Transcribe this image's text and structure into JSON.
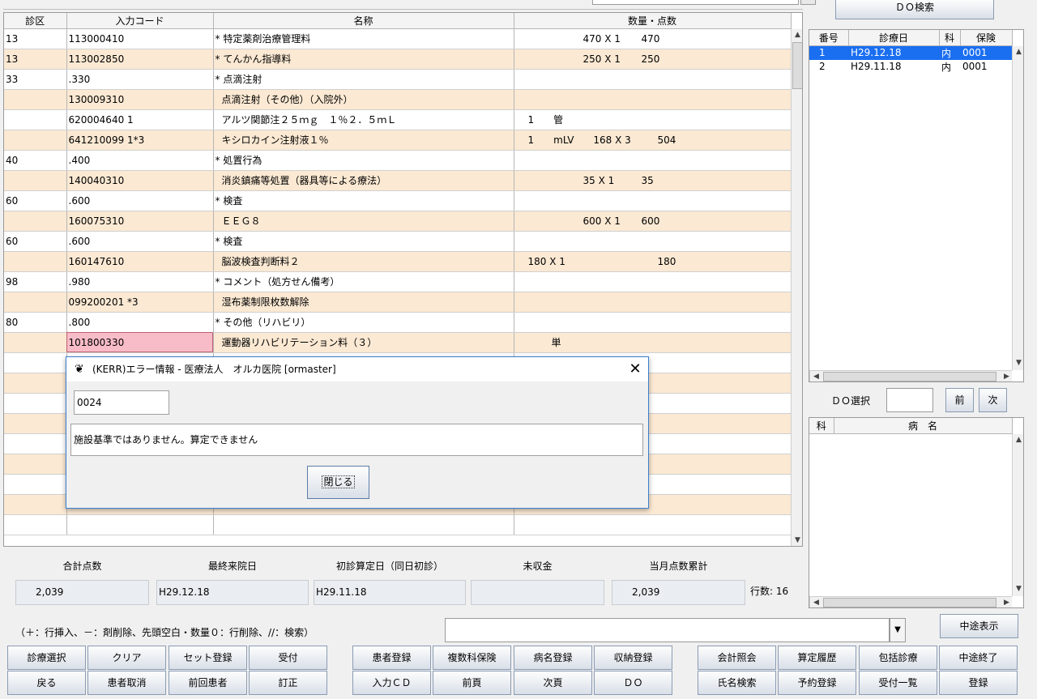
{
  "main_grid": {
    "headers": [
      "診区",
      "入力コード",
      "名称",
      "数量・点数"
    ],
    "rows": [
      {
        "shinku": "13",
        "code": "113000410",
        "name": "* 特定薬剤治療管理料",
        "qty": "470 X 1",
        "points": "470"
      },
      {
        "shinku": "13",
        "code": "113002850",
        "name": "* てんかん指導料",
        "qty": "250 X 1",
        "points": "250"
      },
      {
        "shinku": "33",
        "code": ".330",
        "name": "* 点滴注射",
        "qty": "",
        "points": ""
      },
      {
        "shinku": "",
        "code": "130009310",
        "name": "点滴注射（その他）（入院外）",
        "qty": "",
        "points": ""
      },
      {
        "shinku": "",
        "code": "620004640 1",
        "name": "アルツ関節注２５ｍｇ　１％２．５ｍＬ",
        "qty": "1　　管",
        "points": ""
      },
      {
        "shinku": "",
        "code": "641210099 1*3",
        "name": "キシロカイン注射液１％",
        "qty": "1　　mLV　　168 X 3",
        "points": "504"
      },
      {
        "shinku": "40",
        "code": ".400",
        "name": "* 処置行為",
        "qty": "",
        "points": ""
      },
      {
        "shinku": "",
        "code": "140040310",
        "name": "消炎鎮痛等処置（器具等による療法）",
        "qty": "35 X 1",
        "points": "35"
      },
      {
        "shinku": "60",
        "code": ".600",
        "name": "* 検査",
        "qty": "",
        "points": ""
      },
      {
        "shinku": "",
        "code": "160075310",
        "name": "ＥＥＧ８",
        "qty": "600 X 1",
        "points": "600"
      },
      {
        "shinku": "60",
        "code": ".600",
        "name": "* 検査",
        "qty": "",
        "points": ""
      },
      {
        "shinku": "",
        "code": "160147610",
        "name": "脳波検査判断料２",
        "qty": "180 X 1",
        "points": "180"
      },
      {
        "shinku": "98",
        "code": ".980",
        "name": "* コメント（処方せん備考）",
        "qty": "",
        "points": ""
      },
      {
        "shinku": "",
        "code": "099200201 *3",
        "name": "湿布薬制限枚数解除",
        "qty": "",
        "points": ""
      },
      {
        "shinku": "80",
        "code": ".800",
        "name": "* その他（リハビリ）",
        "qty": "",
        "points": ""
      },
      {
        "shinku": "",
        "code": "101800330",
        "name": "運動器リハビリテーション料（３）",
        "qty": "単",
        "points": ""
      }
    ]
  },
  "do_search_button": "ＤＯ検索",
  "history": {
    "headers": [
      "番号",
      "診療日",
      "科",
      "保険"
    ],
    "rows": [
      {
        "no": "1",
        "date": "H29.12.18",
        "ka": "内",
        "hoken": "0001"
      },
      {
        "no": "2",
        "date": "H29.11.18",
        "ka": "内",
        "hoken": "0001"
      }
    ]
  },
  "do_select": {
    "label": "ＤＯ選択",
    "value": "",
    "prev": "前",
    "next": "次"
  },
  "disease": {
    "headers": [
      "科",
      "病　名"
    ]
  },
  "summary": {
    "labels": [
      "合計点数",
      "最終来院日",
      "初診算定日（同日初診）",
      "未収金",
      "当月点数累計"
    ],
    "values": [
      "2,039",
      "H29.12.18",
      "H29.11.18",
      "",
      "2,039"
    ],
    "row_count": "行数: 16"
  },
  "hint": "（＋：行挿入、－：剤削除、先頭空白・数量０：行削除、//：検索）",
  "command": {
    "value": ""
  },
  "interrupt_display": "中途表示",
  "buttons": {
    "row1a": [
      "診療選択",
      "クリア",
      "セット登録",
      "受付"
    ],
    "row1b": [
      "患者登録",
      "複数科保険",
      "病名登録",
      "収納登録"
    ],
    "row1c": [
      "会計照会",
      "算定履歴",
      "包括診療",
      "中途終了"
    ],
    "row2a": [
      "戻る",
      "患者取消",
      "前回患者",
      "訂正"
    ],
    "row2b": [
      "入力ＣＤ",
      "前頁",
      "次頁",
      "ＤＯ"
    ],
    "row2c": [
      "氏名検索",
      "予約登録",
      "受付一覧",
      "登録"
    ]
  },
  "dialog": {
    "title": "(KERR)エラー情報 - 医療法人　オルカ医院 [ormaster]",
    "code": "0024",
    "message": "施設基準ではありません。算定できません",
    "close": "閉じる"
  }
}
